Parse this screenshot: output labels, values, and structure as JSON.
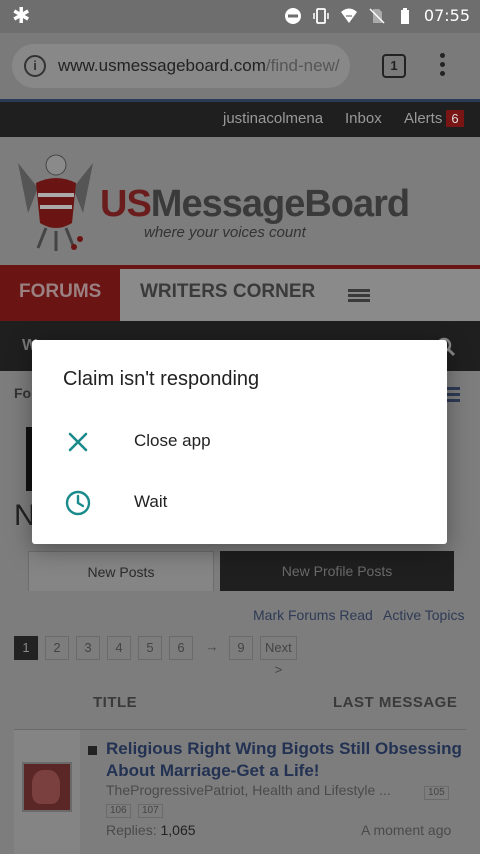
{
  "status_bar": {
    "left_icon": "asterisk-icon",
    "time": "07:55",
    "icons": [
      "do-not-disturb-icon",
      "vibrate-icon",
      "wifi-icon",
      "no-sim-icon",
      "battery-icon"
    ]
  },
  "browser": {
    "url_host": "www.usmessageboard.com",
    "url_path": "/find-new/",
    "tab_count": "1"
  },
  "site": {
    "user_bar": {
      "username": "justinacolmena",
      "inbox": "Inbox",
      "alerts": "Alerts",
      "alerts_count": "6"
    },
    "logo": {
      "text_us": "US",
      "text_rest": "MessageBoard",
      "tagline": "where your voices count"
    },
    "nav": {
      "forums": "FORUMS",
      "writers_corner": "WRITERS CORNER"
    },
    "subnav_letter": "W",
    "breadcrumb": "Fo",
    "big_letter": "N",
    "post_tabs": {
      "new_posts": "New Posts",
      "new_profile_posts": "New Profile Posts"
    },
    "links": {
      "mark_read": "Mark Forums Read",
      "active_topics": "Active Topics"
    },
    "pager": {
      "pages": [
        "1",
        "2",
        "3",
        "4",
        "5",
        "6"
      ],
      "ellipsis": "→",
      "last": "9",
      "next": "Next >"
    },
    "columns": {
      "title": "TITLE",
      "last_message": "LAST MESSAGE"
    },
    "thread": {
      "title": "Religious Right Wing Bigots Still Obsessing About Marriage-Get a Life!",
      "meta": "TheProgressivePatriot, Health and Lifestyle ...",
      "pages": [
        "105",
        "106",
        "107"
      ],
      "replies_label": "Replies:",
      "replies_value": "1,065",
      "time": "A moment ago"
    }
  },
  "dialog": {
    "title": "Claim isn't responding",
    "close_label": "Close app",
    "wait_label": "Wait",
    "accent_color": "#1a8a8a"
  }
}
